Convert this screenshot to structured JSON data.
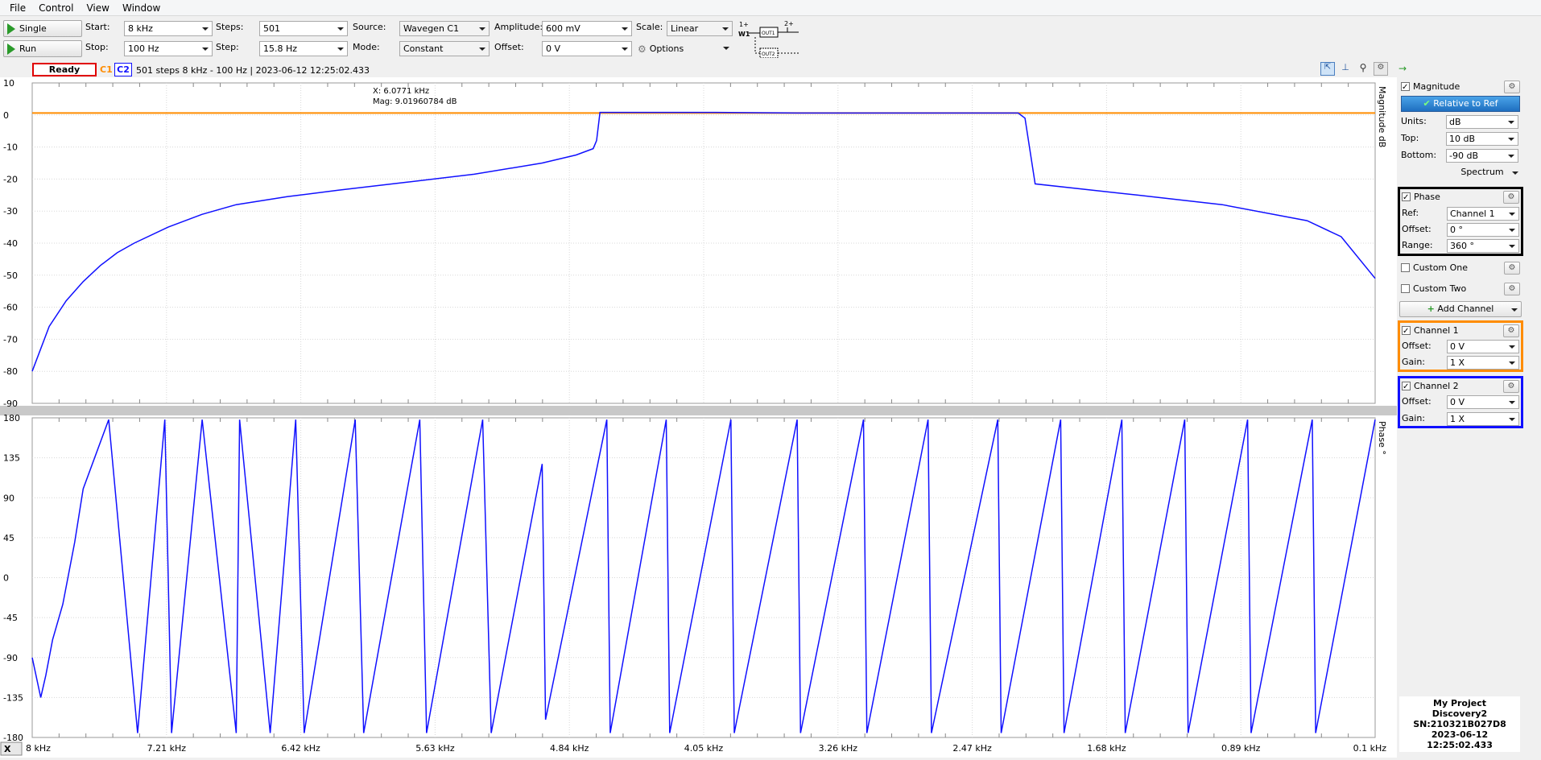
{
  "menu": [
    "File",
    "Control",
    "View",
    "Window"
  ],
  "toolbar": {
    "single_label": "Single",
    "run_label": "Run",
    "start_label": "Start:",
    "start_value": "8 kHz",
    "stop_label": "Stop:",
    "stop_value": "100 Hz",
    "steps_label": "Steps:",
    "steps_value": "501",
    "step_label": "Step:",
    "step_value": "15.8 Hz",
    "source_label": "Source:",
    "source_value": "Wavegen C1",
    "mode_label": "Mode:",
    "mode_value": "Constant",
    "amplitude_label": "Amplitude:",
    "amplitude_value": "600 mV",
    "offset_label": "Offset:",
    "offset_value": "0 V",
    "scale_label": "Scale:",
    "scale_value": "Linear",
    "options_label": "Options",
    "diagram": {
      "w1": "W1",
      "one_plus": "1+",
      "two_plus": "2+",
      "out1": "OUT1",
      "out2": "OUT2"
    }
  },
  "status": {
    "state": "Ready",
    "c1": "C1",
    "c2": "C2",
    "text": "501 steps  8 kHz - 100 Hz | 2023-06-12 12:25:02.433"
  },
  "cursor": {
    "x_text": "X: 6.0771 kHz",
    "mag_text": "Mag: 9.01960784 dB"
  },
  "magnitude_axis": {
    "title": "Magnitude  dB",
    "ticks": [
      "10",
      "0",
      "-10",
      "-20",
      "-30",
      "-40",
      "-50",
      "-60",
      "-70",
      "-80",
      "-90"
    ]
  },
  "phase_axis": {
    "title": "Phase  °",
    "ticks": [
      "180",
      "135",
      "90",
      "45",
      "0",
      "-45",
      "-90",
      "-135",
      "-180"
    ]
  },
  "x_axis": {
    "selector": "X",
    "ticks": [
      "8 kHz",
      "7.21 kHz",
      "6.42 kHz",
      "5.63 kHz",
      "4.84 kHz",
      "4.05 kHz",
      "3.26 kHz",
      "2.47 kHz",
      "1.68 kHz",
      "0.89 kHz",
      "0.1 kHz"
    ]
  },
  "side": {
    "magnitude": {
      "label": "Magnitude",
      "relative_btn": "Relative to Ref",
      "units_label": "Units:",
      "units_value": "dB",
      "top_label": "Top:",
      "top_value": "10 dB",
      "bottom_label": "Bottom:",
      "bottom_value": "-90 dB",
      "spectrum": "Spectrum"
    },
    "phase": {
      "label": "Phase",
      "ref_label": "Ref:",
      "ref_value": "Channel 1",
      "offset_label": "Offset:",
      "offset_value": "0 °",
      "range_label": "Range:",
      "range_value": "360 °"
    },
    "custom_one": "Custom One",
    "custom_two": "Custom Two",
    "add_channel": "Add Channel",
    "channel1": {
      "label": "Channel 1",
      "offset_label": "Offset:",
      "offset_value": "0 V",
      "gain_label": "Gain:",
      "gain_value": "1 X"
    },
    "channel2": {
      "label": "Channel 2",
      "offset_label": "Offset:",
      "offset_value": "0 V",
      "gain_label": "Gain:",
      "gain_value": "1 X"
    },
    "info": {
      "project": "My Project",
      "device": "Discovery2",
      "sn": "SN:210321B027D8",
      "time": "2023-06-12 12:25:02.433"
    }
  },
  "colors": {
    "c1": "#ff8c00",
    "c2": "#1010ff",
    "ready_border": "#e00000"
  },
  "chart_data": [
    {
      "type": "line",
      "x_unit": "kHz",
      "x_range": [
        8,
        0.1
      ],
      "ylim": [
        -90,
        10
      ],
      "series": [
        {
          "name": "C1",
          "x": [
            8,
            0.1
          ],
          "y": [
            0.6,
            0.6
          ]
        },
        {
          "name": "C2",
          "x": [
            8.0,
            7.9,
            7.8,
            7.7,
            7.6,
            7.5,
            7.4,
            7.2,
            7.0,
            6.8,
            6.5,
            6.2,
            5.8,
            5.4,
            5.0,
            4.8,
            4.7,
            4.68,
            4.66,
            4.0,
            3.5,
            3.0,
            2.5,
            2.2,
            2.16,
            2.1,
            1.5,
            1.0,
            0.5,
            0.3,
            0.1
          ],
          "y": [
            -80,
            -66,
            -58,
            -52,
            -47,
            -43,
            -40,
            -35,
            -31,
            -28,
            -25.5,
            -23.5,
            -21,
            -18.5,
            -15,
            -12.5,
            -10.5,
            -8,
            0.8,
            0.8,
            0.6,
            0.6,
            0.6,
            0.6,
            -1,
            -21.5,
            -25,
            -28,
            -33,
            -38,
            -51
          ]
        }
      ]
    },
    {
      "type": "line",
      "x_unit": "kHz",
      "x_range": [
        8,
        0.1
      ],
      "ylim": [
        -180,
        180
      ],
      "series": [
        {
          "name": "C2",
          "x": [
            8.0,
            7.95,
            7.92,
            7.88,
            7.82,
            7.75,
            7.7,
            7.55,
            7.38,
            7.22,
            7.18,
            7.0,
            6.8,
            6.78,
            6.6,
            6.45,
            6.4,
            6.1,
            6.05,
            5.72,
            5.68,
            5.35,
            5.3,
            5.0,
            4.98,
            4.62,
            4.6,
            4.27,
            4.25,
            3.89,
            3.87,
            3.5,
            3.48,
            3.11,
            3.09,
            2.73,
            2.71,
            2.32,
            2.3,
            1.95,
            1.93,
            1.59,
            1.57,
            1.22,
            1.2,
            0.85,
            0.83,
            0.47,
            0.45,
            0.1
          ],
          "y": [
            -90,
            -135,
            -110,
            -70,
            -30,
            40,
            100,
            178,
            -175,
            178,
            -175,
            178,
            -175,
            178,
            -175,
            178,
            -175,
            178,
            -175,
            178,
            -175,
            178,
            -175,
            128,
            -160,
            178,
            -175,
            178,
            -175,
            178,
            -175,
            178,
            -175,
            178,
            -175,
            178,
            -175,
            178,
            -175,
            178,
            -175,
            178,
            -175,
            178,
            -175,
            178,
            -175,
            178,
            -175,
            178
          ]
        }
      ]
    }
  ]
}
